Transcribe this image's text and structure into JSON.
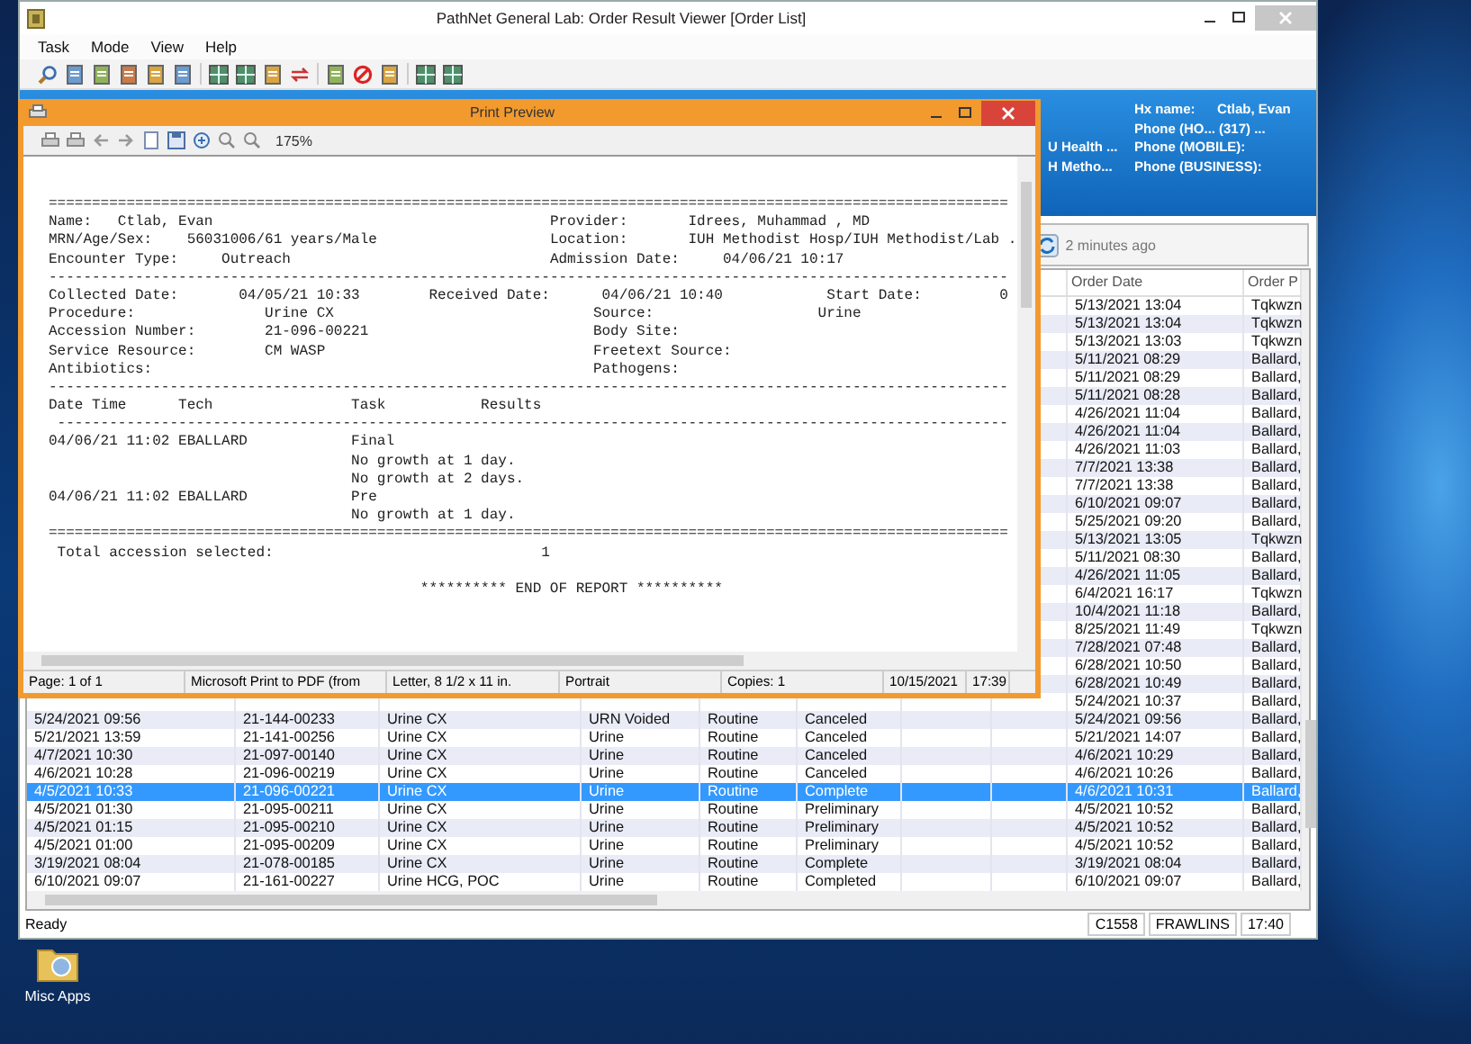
{
  "window": {
    "title": "PathNet General Lab: Order Result Viewer [Order List]"
  },
  "menu": [
    {
      "label": "Task"
    },
    {
      "label": "Mode"
    },
    {
      "label": "View"
    },
    {
      "label": "Help"
    }
  ],
  "banner": {
    "left": [
      "U Health ...",
      "H Metho..."
    ],
    "right": [
      {
        "label": "Hx name:",
        "value": "Ctlab, Evan"
      },
      {
        "label": "Phone (HO...",
        "value": "(317) ..."
      },
      {
        "label": "Phone (MOBILE):"
      },
      {
        "label": "Phone (BUSINESS):"
      }
    ]
  },
  "refresh": {
    "text": "2 minutes ago"
  },
  "table": {
    "columns": [
      {
        "label": "Order Date"
      },
      {
        "label": "Order P"
      }
    ],
    "rows": [
      {
        "order_date": "5/13/2021 13:04",
        "order_p": "Tqkwzn",
        "selected": false
      },
      {
        "order_date": "5/13/2021 13:04",
        "order_p": "Tqkwzn",
        "selected": false
      },
      {
        "order_date": "5/13/2021 13:03",
        "order_p": "Tqkwzn",
        "selected": false
      },
      {
        "order_date": "5/11/2021 08:29",
        "order_p": "Ballard,",
        "selected": false
      },
      {
        "order_date": "5/11/2021 08:29",
        "order_p": "Ballard,",
        "selected": false
      },
      {
        "order_date": "5/11/2021 08:28",
        "order_p": "Ballard,",
        "selected": false
      },
      {
        "order_date": "4/26/2021 11:04",
        "order_p": "Ballard,",
        "selected": false
      },
      {
        "order_date": "4/26/2021 11:04",
        "order_p": "Ballard,",
        "selected": false
      },
      {
        "order_date": "4/26/2021 11:03",
        "order_p": "Ballard,",
        "selected": false
      },
      {
        "order_date": "7/7/2021 13:38",
        "order_p": "Ballard,",
        "selected": false
      },
      {
        "order_date": "7/7/2021 13:38",
        "order_p": "Ballard,",
        "selected": false
      },
      {
        "order_date": "6/10/2021 09:07",
        "order_p": "Ballard,",
        "selected": false
      },
      {
        "order_date": "5/25/2021 09:20",
        "order_p": "Ballard,",
        "selected": false
      },
      {
        "order_date": "5/13/2021 13:05",
        "order_p": "Tqkwzn",
        "selected": false
      },
      {
        "order_date": "5/11/2021 08:30",
        "order_p": "Ballard,",
        "selected": false
      },
      {
        "order_date": "4/26/2021 11:05",
        "order_p": "Ballard,",
        "selected": false
      },
      {
        "order_date": "6/4/2021 16:17",
        "order_p": "Tqkwzn",
        "selected": false
      },
      {
        "order_date": "10/4/2021 11:18",
        "order_p": "Ballard,",
        "selected": false
      },
      {
        "order_date": "8/25/2021 11:49",
        "order_p": "Tqkwzn",
        "selected": false
      },
      {
        "order_date": "7/28/2021 07:48",
        "order_p": "Ballard,",
        "selected": false
      },
      {
        "order_date": "6/28/2021 10:50",
        "order_p": "Ballard,",
        "selected": false
      },
      {
        "order_date": "6/28/2021 10:49",
        "order_p": "Ballard,",
        "selected": false
      },
      {
        "order_date": "5/24/2021 10:37",
        "order_p": "Ballard,",
        "selected": false
      },
      {
        "column_1": "5/24/2021 09:56",
        "column_2": "21-144-00233",
        "column_3": "Urine CX",
        "column_4": "URN Voided",
        "column_5": "Routine",
        "column_6": "Canceled",
        "order_date": "5/24/2021 09:56",
        "order_p": "Ballard,",
        "selected": false
      },
      {
        "column_1": "5/21/2021 13:59",
        "column_2": "21-141-00256",
        "column_3": "Urine CX",
        "column_4": "Urine",
        "column_5": "Routine",
        "column_6": "Canceled",
        "order_date": "5/21/2021 14:07",
        "order_p": "Ballard,",
        "selected": false
      },
      {
        "column_1": "4/7/2021 10:30",
        "column_2": "21-097-00140",
        "column_3": "Urine CX",
        "column_4": "Urine",
        "column_5": "Routine",
        "column_6": "Canceled",
        "order_date": "4/6/2021 10:29",
        "order_p": "Ballard,",
        "selected": false
      },
      {
        "column_1": "4/6/2021 10:28",
        "column_2": "21-096-00219",
        "column_3": "Urine CX",
        "column_4": "Urine",
        "column_5": "Routine",
        "column_6": "Canceled",
        "order_date": "4/6/2021 10:26",
        "order_p": "Ballard,",
        "selected": false
      },
      {
        "column_1": "4/5/2021 10:33",
        "column_2": "21-096-00221",
        "column_3": "Urine CX",
        "column_4": "Urine",
        "column_5": "Routine",
        "column_6": "Complete",
        "order_date": "4/6/2021 10:31",
        "order_p": "Ballard,",
        "selected": true
      },
      {
        "column_1": "4/5/2021 01:30",
        "column_2": "21-095-00211",
        "column_3": "Urine CX",
        "column_4": "Urine",
        "column_5": "Routine",
        "column_6": "Preliminary",
        "order_date": "4/5/2021 10:52",
        "order_p": "Ballard,",
        "selected": false
      },
      {
        "column_1": "4/5/2021 01:15",
        "column_2": "21-095-00210",
        "column_3": "Urine CX",
        "column_4": "Urine",
        "column_5": "Routine",
        "column_6": "Preliminary",
        "order_date": "4/5/2021 10:52",
        "order_p": "Ballard,",
        "selected": false
      },
      {
        "column_1": "4/5/2021 01:00",
        "column_2": "21-095-00209",
        "column_3": "Urine CX",
        "column_4": "Urine",
        "column_5": "Routine",
        "column_6": "Preliminary",
        "order_date": "4/5/2021 10:52",
        "order_p": "Ballard,",
        "selected": false
      },
      {
        "column_1": "3/19/2021 08:04",
        "column_2": "21-078-00185",
        "column_3": "Urine CX",
        "column_4": "Urine",
        "column_5": "Routine",
        "column_6": "Complete",
        "order_date": "3/19/2021 08:04",
        "order_p": "Ballard,",
        "selected": false
      },
      {
        "column_1": "6/10/2021 09:07",
        "column_2": "21-161-00227",
        "column_3": "Urine HCG, POC",
        "column_4": "Urine",
        "column_5": "Routine",
        "column_6": "Completed",
        "order_date": "6/10/2021 09:07",
        "order_p": "Ballard,",
        "selected": false
      }
    ]
  },
  "status_bar": {
    "text": "Ready",
    "panels": [
      "C1558",
      "FRAWLINS",
      "17:40"
    ]
  },
  "print_preview": {
    "title": "Print Preview",
    "zoom": "175%",
    "report_lines": [
      "===============================================================================================================",
      "Name:   Ctlab, Evan                                       Provider:       Idrees, Muhammad , MD",
      "MRN/Age/Sex:    56031006/61 years/Male                    Location:       IUH Methodist Hosp/IUH Methodist/Lab .",
      "Encounter Type:     Outreach                              Admission Date:     04/06/21 10:17",
      "---------------------------------------------------------------------------------------------------------------",
      "Collected Date:       04/05/21 10:33        Received Date:      04/06/21 10:40            Start Date:         0",
      "Procedure:               Urine CX                              Source:                   Urine",
      "Accession Number:        21-096-00221                          Body Site:",
      "Service Resource:        CM WASP                               Freetext Source:",
      "Antibiotics:                                                   Pathogens:",
      "---------------------------------------------------------------------------------------------------------------",
      "Date Time      Tech                Task           Results",
      " --------------------------------------------------------------------------------------------------------------",
      "04/06/21 11:02 EBALLARD            Final",
      "                                   No growth at 1 day.",
      "                                   No growth at 2 days.",
      "04/06/21 11:02 EBALLARD            Pre",
      "                                   No growth at 1 day.",
      "===============================================================================================================",
      " Total accession selected:                               1"
    ],
    "report_footer": "********** END OF REPORT **********",
    "status": [
      "Page: 1 of 1",
      "Microsoft Print to PDF (from",
      "Letter, 8 1/2 x 11 in.",
      "Portrait",
      "Copies: 1",
      "10/15/2021",
      "17:39"
    ]
  },
  "desktop": {
    "icons": [
      {
        "label": "Misc Apps"
      }
    ]
  }
}
